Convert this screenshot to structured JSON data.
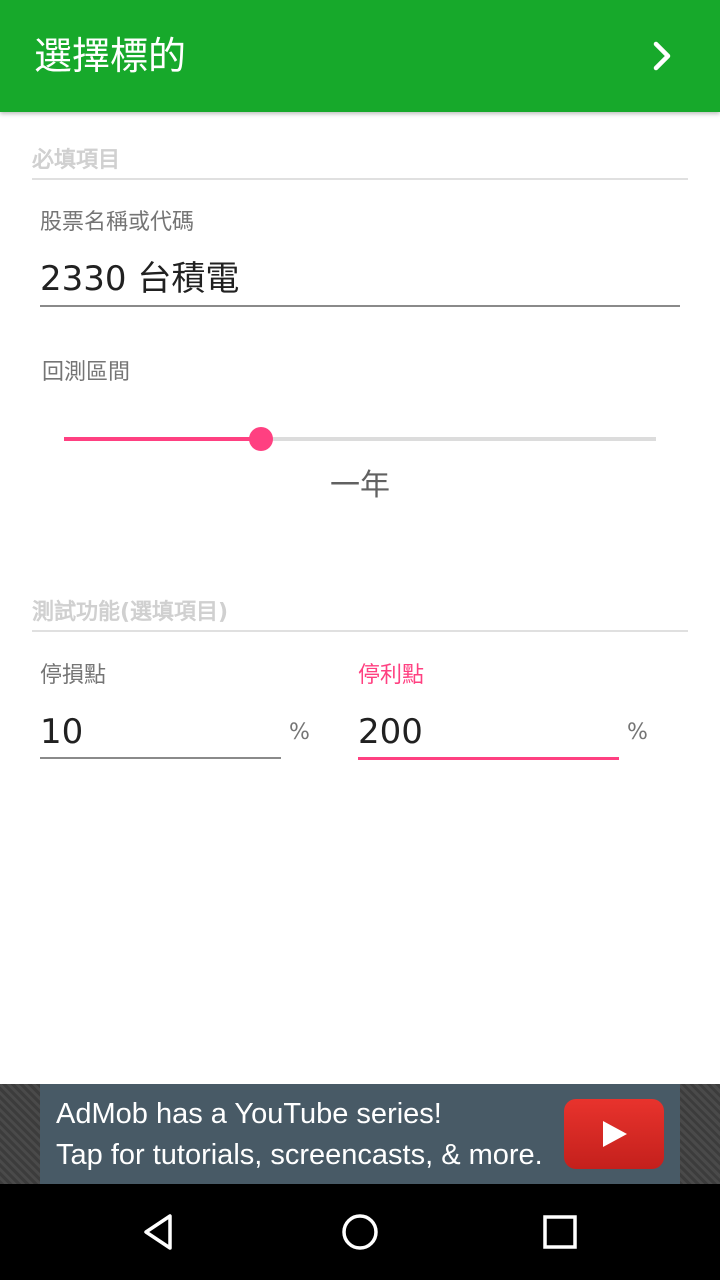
{
  "appbar": {
    "title": "選擇標的",
    "next_icon": "chevron-right-icon"
  },
  "required_section": {
    "header": "必填項目",
    "stock_field": {
      "label": "股票名稱或代碼",
      "value": "2330 台積電"
    },
    "period": {
      "label": "回測區間",
      "value_label": "一年",
      "slider_fraction": 0.333
    }
  },
  "optional_section": {
    "header": "測試功能(選填項目)",
    "stop_loss": {
      "label": "停損點",
      "value": "10",
      "unit": "%"
    },
    "take_profit": {
      "label": "停利點",
      "value": "200",
      "unit": "%"
    }
  },
  "ad": {
    "line1": "AdMob has a YouTube series!",
    "line2": "Tap for tutorials, screencasts, & more.",
    "icon": "youtube-play-icon"
  },
  "navbar": {
    "back_icon": "back-triangle-icon",
    "home_icon": "home-circle-icon",
    "recents_icon": "recents-square-icon"
  },
  "colors": {
    "appbar": "#17a92b",
    "accent": "#ff4081"
  }
}
